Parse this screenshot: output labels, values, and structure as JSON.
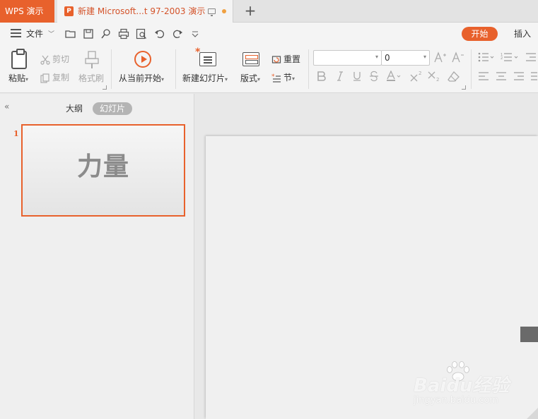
{
  "titlebar": {
    "app_name": "WPS 演示",
    "doc_title": "新建 Microsoft...t 97-2003 演示",
    "new_tab": "+",
    "doc_icon_letter": "P"
  },
  "quickbar": {
    "file_label": "文件",
    "start_label": "开始",
    "insert_label": "插入"
  },
  "ribbon": {
    "paste": "粘贴",
    "cut": "剪切",
    "copy": "复制",
    "format_painter": "格式刷",
    "from_current": "从当前开始",
    "new_slide": "新建幻灯片",
    "layout": "版式",
    "reset": "重置",
    "section": "节",
    "font_name": "",
    "font_size": "0",
    "caret": "▾"
  },
  "panel": {
    "tab_outline": "大纲",
    "tab_slides": "幻灯片",
    "slide_number": "1",
    "slide_title": "力量"
  },
  "watermark": {
    "logo": "Baidu经验",
    "url": "jingyan.baidu.com"
  },
  "colors": {
    "accent": "#e8612c"
  }
}
